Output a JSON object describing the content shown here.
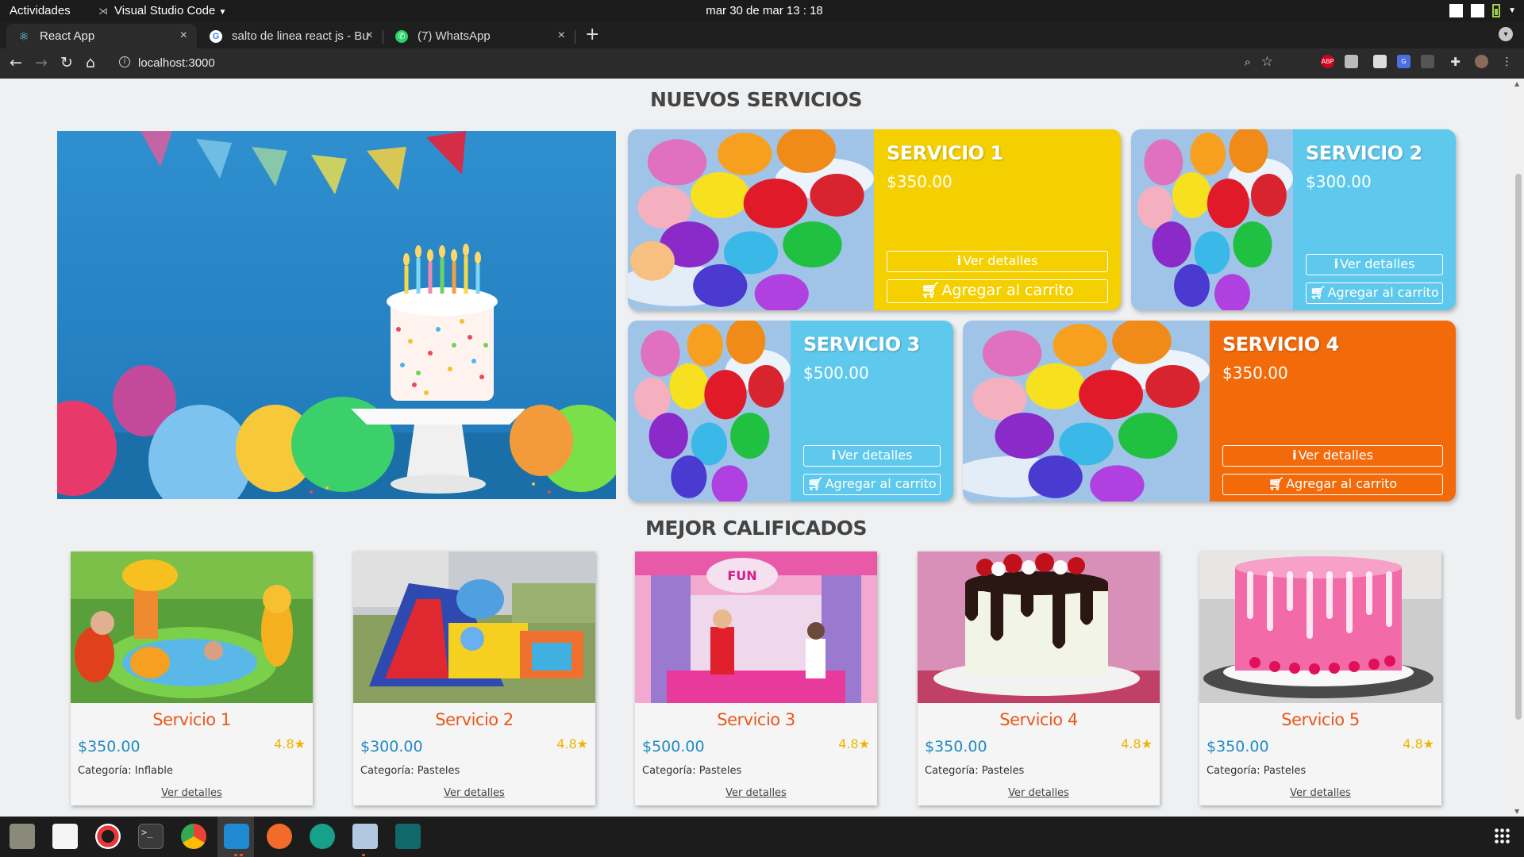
{
  "system": {
    "activities": "Actividades",
    "app_menu": "Visual Studio Code",
    "clock": "mar 30 de mar  13 : 18"
  },
  "browser": {
    "tabs": [
      {
        "title": "React App",
        "icon": "react-icon",
        "active": true
      },
      {
        "title": "salto de linea react js - Bu",
        "icon": "google-icon",
        "active": false
      },
      {
        "title": "(7) WhatsApp",
        "icon": "whatsapp-icon",
        "active": false
      }
    ],
    "url": "localhost:3000",
    "extensions": [
      "abp-icon",
      "extension-icon",
      "extension-icon",
      "translate-icon",
      "extension-icon",
      "puzzle-icon",
      "profile-icon"
    ]
  },
  "page": {
    "new_services_title": "NUEVOS SERVICIOS",
    "top_rated_title": "MEJOR CALIFICADOS",
    "services": [
      {
        "name": "SERVICIO 1",
        "price": "$350.00",
        "details_label": "Ver detalles",
        "cart_label": "Agregar al carrito",
        "color": "#f5d000"
      },
      {
        "name": "SERVICIO 2",
        "price": "$300.00",
        "details_label": "Ver detalles",
        "cart_label": "Agregar al carrito",
        "color": "#5ec9ec"
      },
      {
        "name": "SERVICIO 3",
        "price": "$500.00",
        "details_label": "Ver detalles",
        "cart_label": "Agregar al carrito",
        "color": "#5ec9ec"
      },
      {
        "name": "SERVICIO 4",
        "price": "$350.00",
        "details_label": "Ver detalles",
        "cart_label": "Agregar al carrito",
        "color": "#f26a0a"
      }
    ],
    "rated": [
      {
        "name": "Servicio 1",
        "price": "$350.00",
        "rating": "4.8",
        "category": "Categoría: Inflable",
        "details_label": "Ver detalles"
      },
      {
        "name": "Servicio 2",
        "price": "$300.00",
        "rating": "4.8",
        "category": "Categoría: Pasteles",
        "details_label": "Ver detalles"
      },
      {
        "name": "Servicio 3",
        "price": "$500.00",
        "rating": "4.8",
        "category": "Categoría: Pasteles",
        "details_label": "Ver detalles"
      },
      {
        "name": "Servicio 4",
        "price": "$350.00",
        "rating": "4.8",
        "category": "Categoría: Pasteles",
        "details_label": "Ver detalles"
      },
      {
        "name": "Servicio 5",
        "price": "$350.00",
        "rating": "4.8",
        "category": "Categoría: Pasteles",
        "details_label": "Ver detalles"
      }
    ]
  },
  "dock": [
    "files-icon",
    "software-icon",
    "help-icon",
    "terminal-icon",
    "chrome-icon",
    "vscode-icon",
    "postman-icon",
    "gitkraken-icon",
    "screenshot-icon",
    "app-icon"
  ]
}
